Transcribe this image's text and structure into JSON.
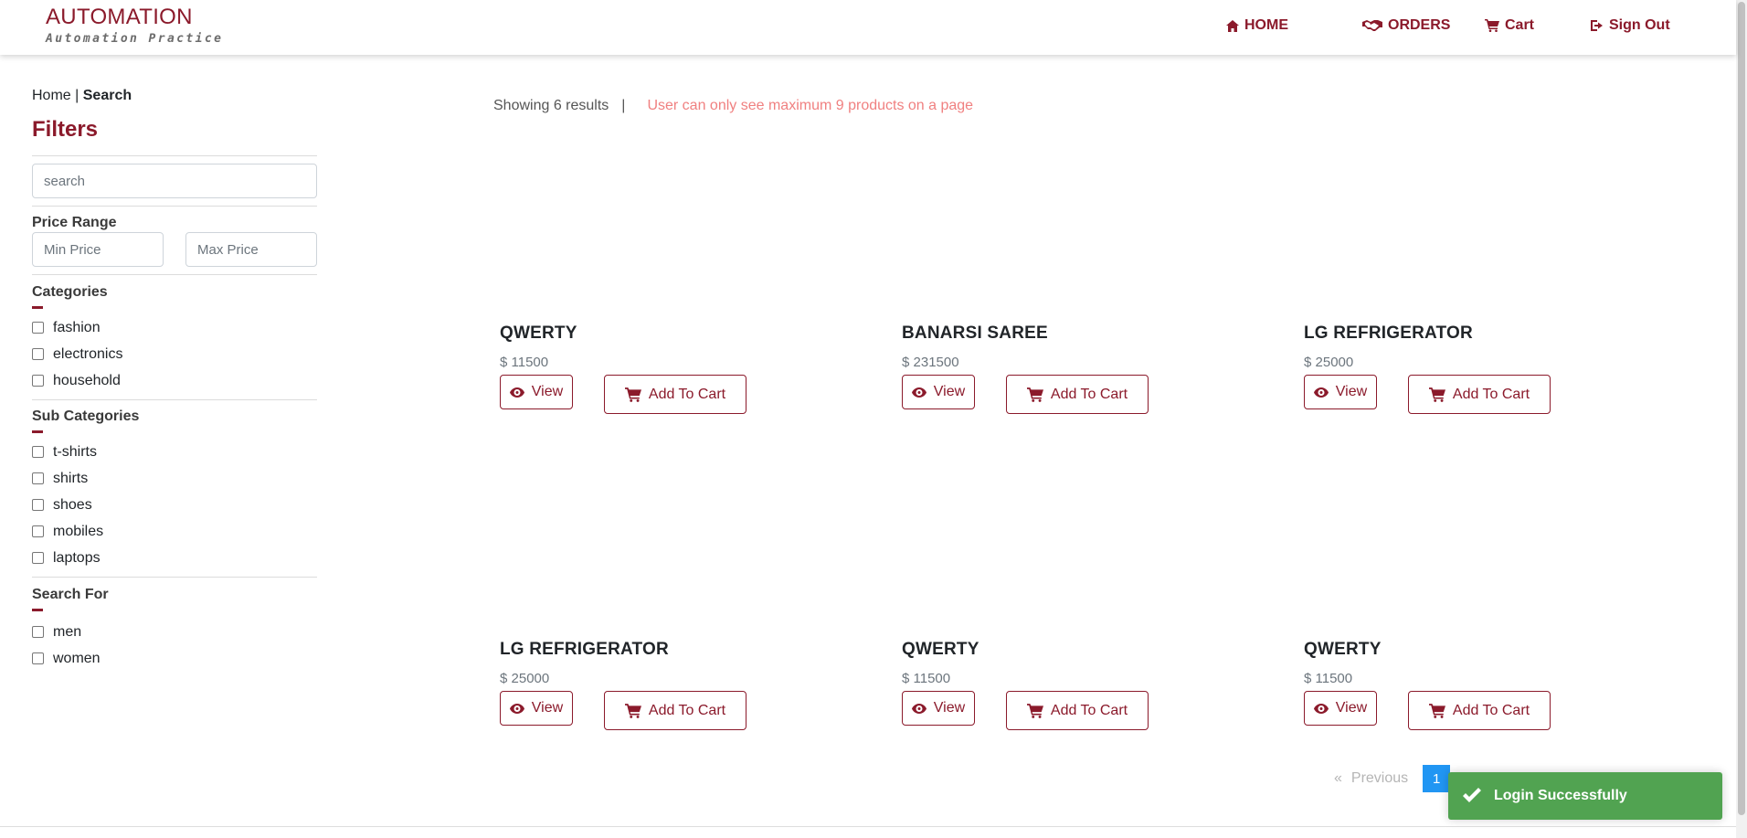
{
  "brand": {
    "title": "AUTOMATION",
    "subtitle": "Automation Practice"
  },
  "nav": {
    "home": "HOME",
    "orders": "ORDERS",
    "cart": "Cart",
    "signout": "Sign Out"
  },
  "breadcrumb": {
    "home": "Home",
    "separator": "|",
    "current": "Search"
  },
  "filters": {
    "title": "Filters",
    "search_placeholder": "search",
    "price_range_label": "Price Range",
    "min_price_placeholder": "Min Price",
    "max_price_placeholder": "Max Price",
    "categories_title": "Categories",
    "categories": [
      "fashion",
      "electronics",
      "household"
    ],
    "subcategories_title": "Sub Categories",
    "subcategories": [
      "t-shirts",
      "shirts",
      "shoes",
      "mobiles",
      "laptops"
    ],
    "search_for_title": "Search For",
    "search_for": [
      "men",
      "women"
    ]
  },
  "results": {
    "count_text": "Showing 6 results",
    "separator": "|",
    "note": "User can only see maximum 9 products on a page"
  },
  "products": [
    {
      "name": "QWERTY",
      "price": "$ 11500",
      "view": "View",
      "add": "Add To Cart"
    },
    {
      "name": "BANARSI SAREE",
      "price": "$ 231500",
      "view": "View",
      "add": "Add To Cart"
    },
    {
      "name": "LG REFRIGERATOR",
      "price": "$ 25000",
      "view": "View",
      "add": "Add To Cart"
    },
    {
      "name": "LG REFRIGERATOR",
      "price": "$ 25000",
      "view": "View",
      "add": "Add To Cart"
    },
    {
      "name": "QWERTY",
      "price": "$ 11500",
      "view": "View",
      "add": "Add To Cart"
    },
    {
      "name": "QWERTY",
      "price": "$ 11500",
      "view": "View",
      "add": "Add To Cart"
    }
  ],
  "pagination": {
    "prev_arrow": "«",
    "prev": "Previous",
    "current": "1"
  },
  "toast": {
    "message": "Login Successfully"
  },
  "colors": {
    "brand": "#8b1a2b",
    "toast": "#51a351",
    "page_active": "#2196f3",
    "note": "#f08080"
  }
}
